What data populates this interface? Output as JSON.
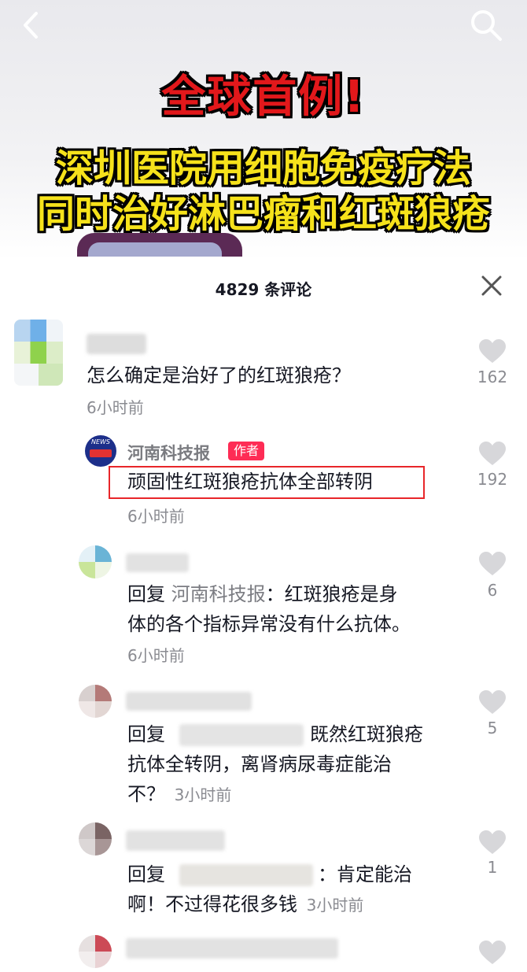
{
  "video": {
    "headline_line1": "全球首例!",
    "headline_line2": "深圳医院用细胞免疫疗法",
    "headline_line3": "同时治好淋巴瘤和红斑狼疮"
  },
  "nav": {
    "back_icon": "chevron-left-icon",
    "search_icon": "search-icon"
  },
  "comments_panel": {
    "title": "4829 条评论",
    "close_icon": "close-icon"
  },
  "comments": [
    {
      "text": "怎么确定是治好了的红斑狼疮？",
      "time": "6小时前",
      "likes": "162"
    },
    {
      "author": "河南科技报",
      "badge": "作者",
      "avatar_text": "NEWS",
      "text": "顽固性红斑狼疮抗体全部转阴",
      "time": "6小时前",
      "likes": "192"
    },
    {
      "reply_prefix": "回复",
      "reply_to": "河南科技报",
      "line1_rest": "：红斑狼疮是身",
      "line2": "体的各个指标异常没有什么抗体。",
      "time": "6小时前",
      "likes": "6"
    },
    {
      "reply_prefix": "回复",
      "line1_rest": "既然红斑狼疮",
      "line2": "抗体全转阴，离肾病尿毒症能治",
      "line3": "不？",
      "time": "3小时前",
      "likes": "5"
    },
    {
      "reply_prefix": "回复",
      "line1_rest": "：肯定能治",
      "line2": "啊！不过得花很多钱",
      "time": "3小时前",
      "likes": "1"
    }
  ]
}
